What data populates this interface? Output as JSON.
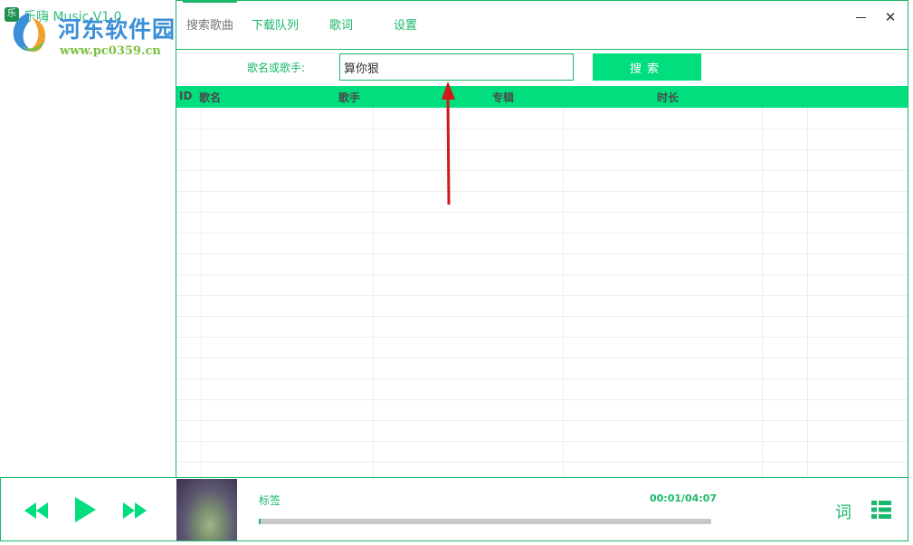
{
  "app": {
    "title": "乐嗨 Music V1.0",
    "logo_char": "乐"
  },
  "watermark": {
    "text": "河东软件园",
    "url": "www.pc0359.cn"
  },
  "nav": {
    "tabs": [
      {
        "label": "搜索歌曲",
        "active": true
      },
      {
        "label": "下载队列"
      },
      {
        "label": "歌词"
      },
      {
        "label": "设置"
      }
    ]
  },
  "window_controls": {
    "close_glyph": "✕"
  },
  "search": {
    "label": "歌名或歌手:",
    "value": "算你狠",
    "button_label": "搜索"
  },
  "table": {
    "columns": [
      "ID",
      "歌名",
      "歌手",
      "专辑",
      "时长"
    ],
    "rows": []
  },
  "player": {
    "track_title": "标签",
    "time": "00:01/04:07",
    "progress": 0.004,
    "lyrics_button": "词"
  },
  "colors": {
    "accent": "#19b86a",
    "header_bg": "#00de7e",
    "annotation": "#e02020"
  },
  "icons": [
    "prev-icon",
    "play-icon",
    "next-icon",
    "playlist-grid-icon",
    "close-icon",
    "minimize-icon"
  ]
}
